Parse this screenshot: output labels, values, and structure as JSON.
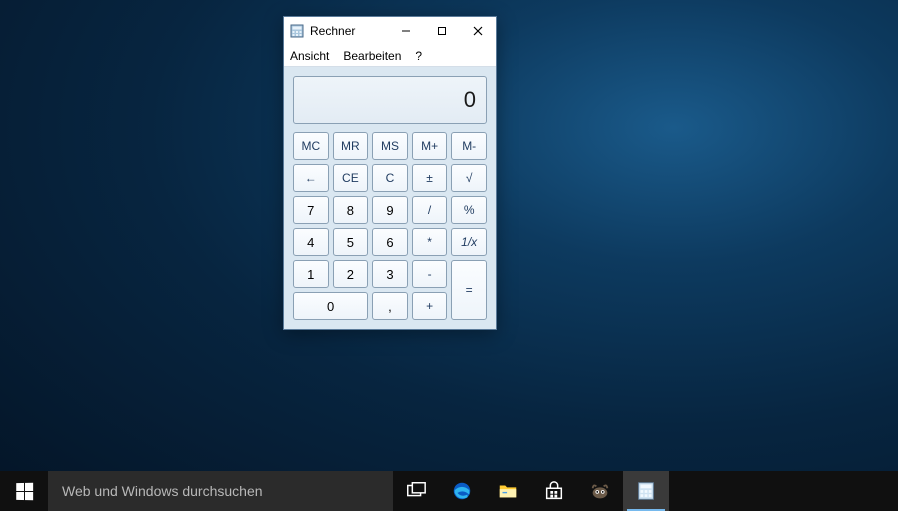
{
  "window": {
    "title": "Rechner"
  },
  "menu": {
    "view": "Ansicht",
    "edit": "Bearbeiten",
    "help": "?"
  },
  "display": {
    "value": "0"
  },
  "keys": {
    "mc": "MC",
    "mr": "MR",
    "ms": "MS",
    "mplus": "M+",
    "mminus": "M-",
    "back": "←",
    "ce": "CE",
    "c": "C",
    "neg": "±",
    "sqrt": "√",
    "k7": "7",
    "k8": "8",
    "k9": "9",
    "div": "/",
    "pct": "%",
    "k4": "4",
    "k5": "5",
    "k6": "6",
    "mul": "*",
    "inv": "1/x",
    "k1": "1",
    "k2": "2",
    "k3": "3",
    "sub": "-",
    "eq": "=",
    "k0": "0",
    "dec": ",",
    "add": "+"
  },
  "taskbar": {
    "search_placeholder": "Web und Windows durchsuchen"
  }
}
